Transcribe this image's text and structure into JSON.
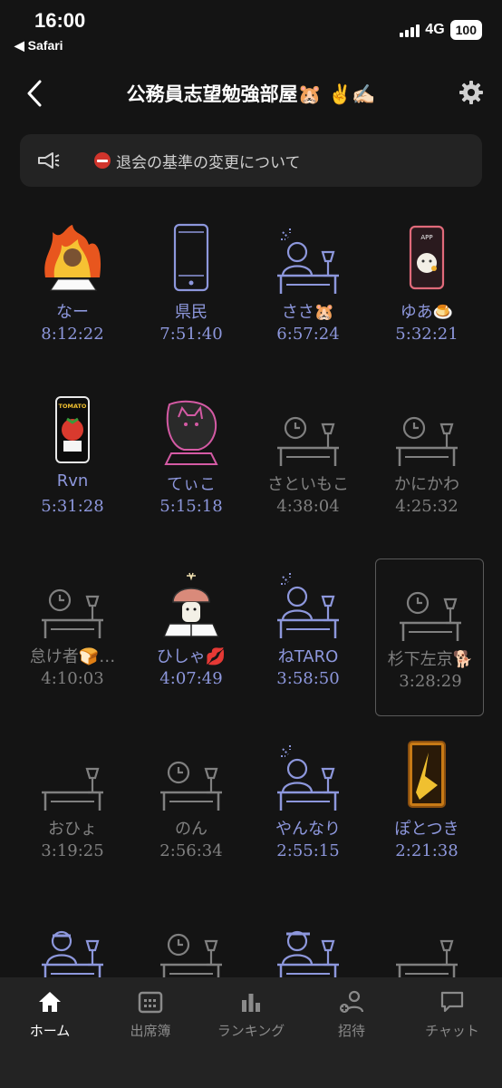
{
  "status_bar": {
    "time": "16:00",
    "back_app": "◀ Safari",
    "network": "4G",
    "battery": "100"
  },
  "header": {
    "title": "公務員志望勉強部屋🐹 ✌️✍🏻"
  },
  "notice": {
    "text": "退会の基準の変更について"
  },
  "members": [
    {
      "name": "なー",
      "time": "8:12:22",
      "active": true,
      "art": "avatar-fire"
    },
    {
      "name": "県民",
      "time": "7:51:40",
      "active": true,
      "art": "phone"
    },
    {
      "name": "ささ🐹",
      "time": "6:57:24",
      "active": true,
      "art": "desk-person"
    },
    {
      "name": "ゆあ🍮",
      "time": "5:32:21",
      "active": true,
      "art": "phone-app"
    },
    {
      "name": "Rvn",
      "time": "5:31:28",
      "active": true,
      "art": "phone-tomato"
    },
    {
      "name": "てぃこ",
      "time": "5:15:18",
      "active": true,
      "art": "avatar-cat"
    },
    {
      "name": "さといもこ",
      "time": "4:38:04",
      "active": false,
      "art": "desk-clock"
    },
    {
      "name": "かにかわ",
      "time": "4:25:32",
      "active": false,
      "art": "desk-clock"
    },
    {
      "name": "怠け者🍞…",
      "time": "4:10:03",
      "active": false,
      "art": "desk-clock"
    },
    {
      "name": "ひしゃ💋",
      "time": "4:07:49",
      "active": true,
      "art": "avatar-mushroom"
    },
    {
      "name": "ねTARO",
      "time": "3:58:50",
      "active": true,
      "art": "desk-person"
    },
    {
      "name": "杉下左京🐕",
      "time": "3:28:29",
      "active": false,
      "art": "desk-clock",
      "selected": true
    },
    {
      "name": "おひょ",
      "time": "3:19:25",
      "active": false,
      "art": "desk"
    },
    {
      "name": "のん",
      "time": "2:56:34",
      "active": false,
      "art": "desk-clock"
    },
    {
      "name": "やんなり",
      "time": "2:55:15",
      "active": true,
      "art": "desk-person"
    },
    {
      "name": "ぽとつき",
      "time": "2:21:38",
      "active": true,
      "art": "phone-gold"
    },
    {
      "name": "",
      "time": "",
      "active": true,
      "art": "desk-person-lamp"
    },
    {
      "name": "",
      "time": "",
      "active": false,
      "art": "desk-clock"
    },
    {
      "name": "",
      "time": "",
      "active": true,
      "art": "desk-person-cap"
    },
    {
      "name": "",
      "time": "",
      "active": false,
      "art": "desk"
    }
  ],
  "tabs": [
    {
      "label": "ホーム",
      "icon": "home-icon",
      "active": true
    },
    {
      "label": "出席簿",
      "icon": "calendar-icon",
      "active": false
    },
    {
      "label": "ランキング",
      "icon": "ranking-icon",
      "active": false
    },
    {
      "label": "招待",
      "icon": "invite-icon",
      "active": false
    },
    {
      "label": "チャット",
      "icon": "chat-icon",
      "active": false
    }
  ],
  "colors": {
    "accent": "#8d97dc",
    "idle": "#808080",
    "background": "#141414",
    "panel": "#232323"
  }
}
